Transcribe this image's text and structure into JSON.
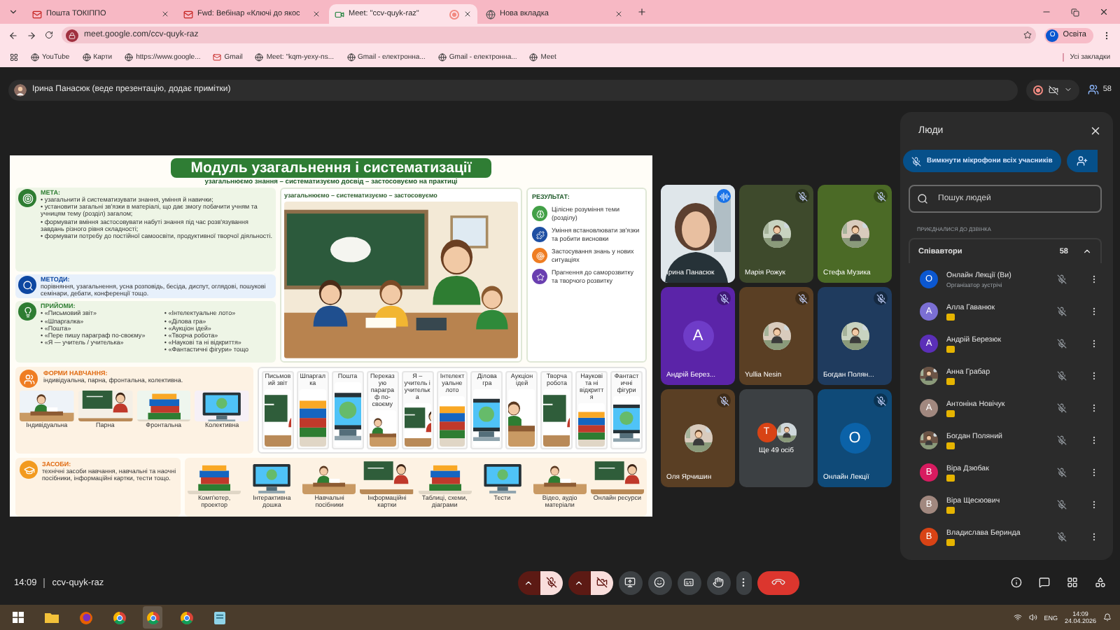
{
  "browser": {
    "tabs": [
      {
        "title": "Пошта ТОКІППО",
        "selected": false,
        "kind": "mail"
      },
      {
        "title": "Fwd: Вебінар «Ключі до якос",
        "selected": false,
        "kind": "mail"
      },
      {
        "title": "Meet: \"ccv-quyk-raz\"",
        "selected": true,
        "kind": "meet"
      },
      {
        "title": "Нова вкладка",
        "selected": false,
        "kind": "blank"
      }
    ],
    "address": "meet.google.com/ccv-quyk-raz",
    "profile_initial": "О",
    "profile": "Освіта",
    "bookmarks": [
      {
        "label": "YouTube",
        "kind": "globe"
      },
      {
        "label": "Карти",
        "kind": "globe"
      },
      {
        "label": "https://www.google...",
        "kind": "globe"
      },
      {
        "label": "Gmail",
        "kind": "mail"
      },
      {
        "label": "Meet: \"kqm-yexy-ns...",
        "kind": "globe"
      },
      {
        "label": "Gmail - електронна...",
        "kind": "globe"
      },
      {
        "label": "Gmail - електронна...",
        "kind": "globe"
      },
      {
        "label": "Meet",
        "kind": "globe"
      }
    ],
    "all_bookmarks": "Усі закладки"
  },
  "meet": {
    "presenter": "Ірина Панасюк (веде презентацію, додає примітки)",
    "participant_count": "58"
  },
  "slide": {
    "title": "Модуль узагальнення і систематизації",
    "subtitle": "узагальнюємо знання – систематизуємо досвід – застосовуємо на практиці",
    "goal": {
      "heading": "МЕТА:",
      "items": [
        "• узагальнити й систематизувати знання, уміння й навички;",
        "• установити загальні зв'язки в матеріалі, що дає змогу побачити учням та учницям тему (розділ) загалом;",
        "• формувати вміння застосовувати набуті знання під час розв'язування завдань різного рівня складності;",
        "• формувати потребу до постійної самоосвіти, продуктивної творчої діяльності."
      ]
    },
    "methods": {
      "heading": "МЕТОДИ:",
      "text": "порівняння, узагальнення, усна розповідь, бесіда, диспут, оглядові, пошукові семінари, дебати, конференції тощо."
    },
    "techniques": {
      "heading": "ПРИЙОМИ:",
      "left": [
        "• «Письмовий звіт»",
        "• «Шпаргалка»",
        "• «Пошта»",
        "• «Пере пишу параграф по-своєму»",
        "• «Я — учитель / учителька»"
      ],
      "right": [
        "• «Інтелектуальне лото»",
        "• «Ділова гра»",
        "• «Аукціон ідей»",
        "• «Творча робота»",
        "• «Наукові та ні відкриття»",
        "• «Фантастичні фігури» тощо"
      ]
    },
    "illustration_caption": "узагальнюємо – систематизуємо – застосовуємо",
    "results": {
      "heading": "РЕЗУЛЬТАТ:",
      "items": [
        "Цілісне розуміння теми (розділу)",
        "Уміння встановлювати зв'язки та робити висновки",
        "Застосування знань у нових ситуаціях",
        "Прагнення до саморозвитку та творчого розвитку"
      ]
    },
    "forms": {
      "heading": "ФОРМИ НАВЧАННЯ:",
      "text": "індивідуальна, парна, фронтальна, колективна.",
      "pictures": [
        "Індивідуальна",
        "Парна",
        "Фронтальна",
        "Колективна"
      ]
    },
    "technique_cards": [
      "Письмовий звіт",
      "Шпаргалка",
      "Пошта",
      "Переказую параграф по-своєму",
      "Я – учитель і учителька",
      "Інтелектуальне лото",
      "Ділова гра",
      "Аукціон ідей",
      "Творча робота",
      "Наукові та ні відкриття",
      "Фантастичні фігури"
    ],
    "means": {
      "heading": "ЗАСОБИ:",
      "text": "технічні засоби навчання, навчальні та наочні посібники, інформаційні картки, тести тощо.",
      "items": [
        "Комп'ютер, проектор",
        "Інтерактивна дошка",
        "Навчальні посібники",
        "Інформаційні картки",
        "Таблиці, схеми, діаграми",
        "Тести",
        "Відео, аудіо матеріали",
        "Онлайн ресурси"
      ]
    }
  },
  "tiles": [
    {
      "name": "Ірина Панасюк",
      "kind": "video",
      "muted": false,
      "color": "#6d7780"
    },
    {
      "name": "Марія Рожук",
      "muted": true,
      "color": "#3e4a2c"
    },
    {
      "name": "Стефа Музика",
      "muted": true,
      "color": "#4b6a26"
    },
    {
      "name": "Андрій Берез...",
      "kind": "initial",
      "initial": "А",
      "muted": true,
      "color": "#5b24a8"
    },
    {
      "name": "Yullia Nesin",
      "muted": true,
      "color": "#5a3f24"
    },
    {
      "name": "Богдан Полян...",
      "muted": true,
      "color": "#1f3b5e"
    },
    {
      "name": "Оля Ярчишин",
      "muted": true,
      "color": "#5a3f24"
    },
    {
      "name": "Ще 49 осіб",
      "kind": "more",
      "initial": "Т",
      "color": "#3c4043"
    },
    {
      "name": "Онлайн Лекції",
      "kind": "initial",
      "initial": "О",
      "muted": true,
      "color": "#0f4a78"
    }
  ],
  "people": {
    "title": "Люди",
    "mute_all": "Вимкнути мікрофони всіх учасників",
    "search_placeholder": "Пошук людей",
    "section": "ПРИЄДНАЛИСЯ ДО ДЗВІНКА",
    "group": "Співавтори",
    "group_count": "58",
    "expanded": true,
    "list": [
      {
        "name": "Онлайн Лекції (Ви)",
        "role": "Організатор зустрічі",
        "initial": "О",
        "color": "#0b57d0",
        "co_host": false
      },
      {
        "name": "Алла Гаванюк",
        "initial": "А",
        "color": "#7b6fd4",
        "co_host": true
      },
      {
        "name": "Андрій Березюк",
        "initial": "А",
        "color": "#5b2fb8",
        "co_host": true
      },
      {
        "name": "Анна Грабар",
        "co_host": true
      },
      {
        "name": "Антоніна Новічук",
        "initial": "А",
        "color": "#a1887f",
        "co_host": true
      },
      {
        "name": "Богдан Поляний",
        "co_host": true
      },
      {
        "name": "Віра Дзюбак",
        "initial": "В",
        "color": "#d81b60",
        "co_host": true
      },
      {
        "name": "Віра Щесюович",
        "initial": "В",
        "color": "#a1887f",
        "co_host": true
      },
      {
        "name": "Владислава Беринда",
        "initial": "В",
        "color": "#d84315",
        "co_host": true
      }
    ]
  },
  "call": {
    "time": "14:09",
    "code": "ccv-quyk-raz",
    "mic_on": false,
    "camera_on": false
  },
  "taskbar": {
    "lang": "ENG",
    "time": "14:09",
    "date": "24.04.2026"
  }
}
